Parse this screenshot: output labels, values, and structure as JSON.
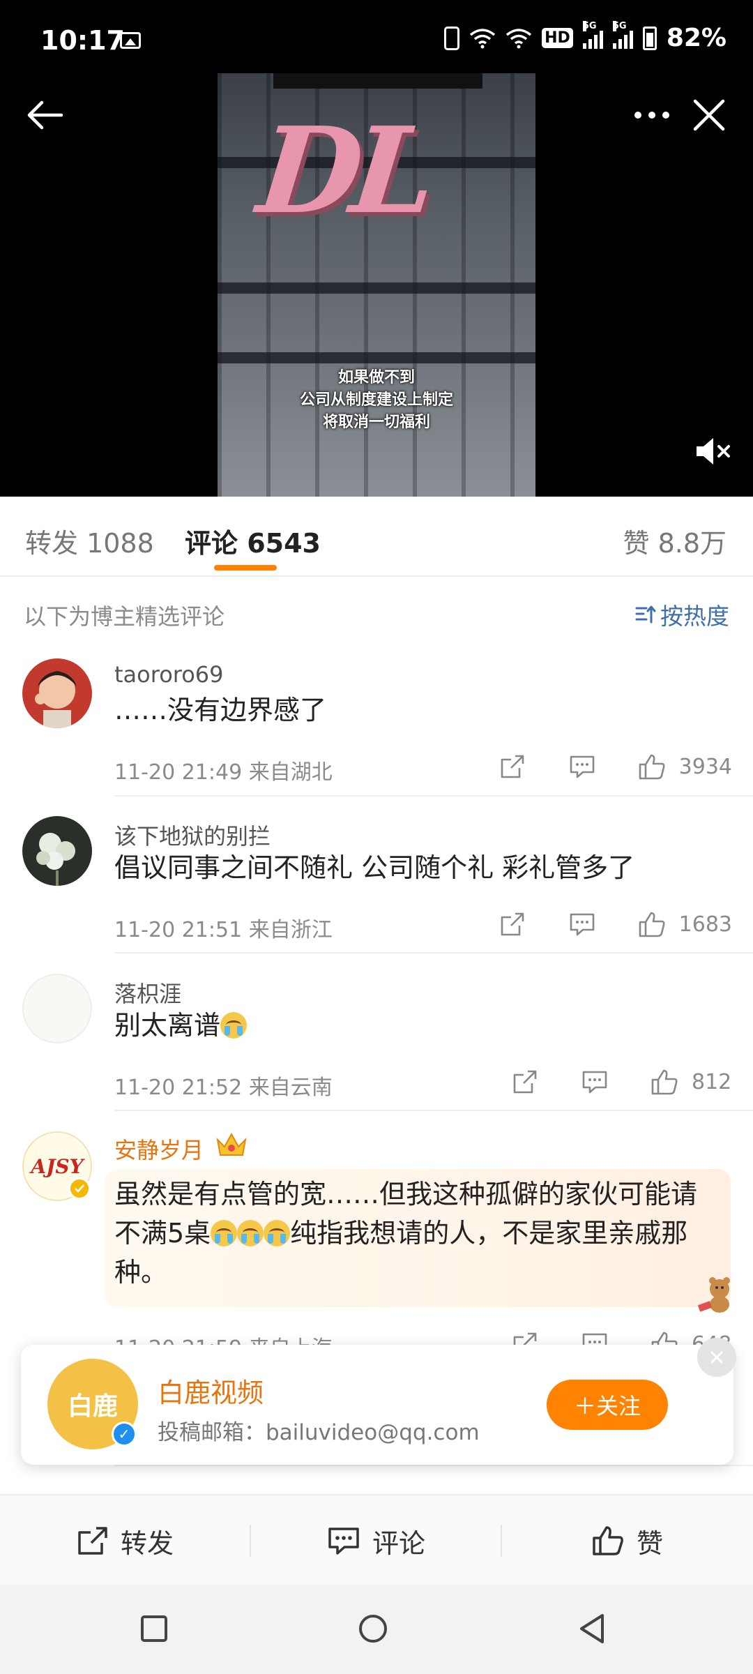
{
  "status_bar": {
    "time": "10:17",
    "network_badge": "HD",
    "network_gen_1": "5G",
    "network_gen_2": "5G",
    "battery": "82%"
  },
  "nav": {
    "back_icon": "arrow-left-icon",
    "more_icon": "more-dots-icon",
    "close_icon": "close-icon"
  },
  "video": {
    "logo_text": "DL",
    "caption_lines": [
      "如果做不到",
      "公司从制度建设上制定",
      "将取消一切福利"
    ],
    "mute_icon": "speaker-muted-icon"
  },
  "tabs": {
    "repost": "转发 1088",
    "comments": "评论 6543",
    "likes": "赞 8.8万"
  },
  "subheader": {
    "label": "以下为博主精选评论",
    "sort_label": "按热度"
  },
  "comments": [
    {
      "username": "taororo69",
      "text": "……没有边界感了",
      "time": "11-20 21:49",
      "location": "来自湖北",
      "likes": "3934"
    },
    {
      "username": "该下地狱的别拦",
      "text": "倡议同事之间不随礼 公司随个礼 彩礼管多了",
      "time": "11-20 21:51",
      "location": "来自浙江",
      "likes": "1683"
    },
    {
      "username": "落枳涯",
      "text": "别太离谱",
      "time": "11-20 21:52",
      "location": "来自云南",
      "likes": "812"
    },
    {
      "username": "安静岁月",
      "text_line1": "虽然是有点管的宽……但我这种孤僻的家伙可能请",
      "text_line2_a": "不满5桌",
      "text_line2_b": "纯指我想请的人，不是家里亲戚那",
      "text_line3": "种。",
      "time": "11-20 21:59",
      "location": "来自上海",
      "likes": "648",
      "avatar_text": "AJSY"
    }
  ],
  "follow_card": {
    "avatar_text": "白鹿",
    "name": "白鹿视频",
    "desc": "投稿邮箱：bailuvideo@qq.com",
    "follow_label": "＋关注"
  },
  "bottom_bar": {
    "repost": "转发",
    "comment": "评论",
    "like": "赞"
  },
  "colors": {
    "accent": "#ff8200",
    "link": "#3e6fa8",
    "vip_name": "#e8740e"
  }
}
